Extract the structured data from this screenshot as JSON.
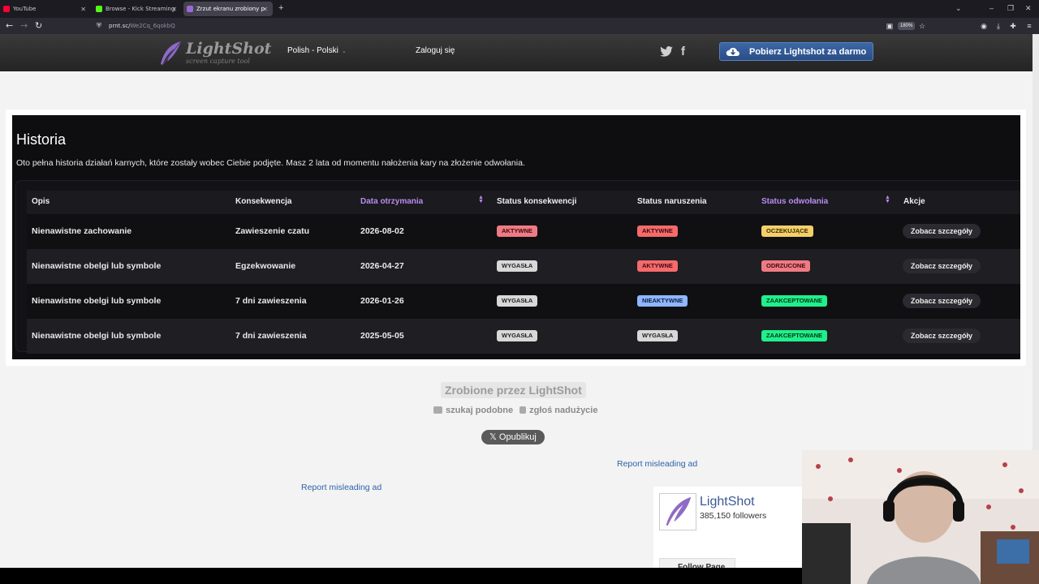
{
  "browser": {
    "tabs": [
      {
        "title": "YouTube",
        "color": "#ff0033"
      },
      {
        "title": "Browse - Kick Streaming",
        "color": "#53fc18"
      },
      {
        "title": "Zrzut ekranu zrobiony przez Li...",
        "color": "#9b6ad1"
      }
    ],
    "url": "prnt.sc/",
    "url_path": "We2Cq_6qokbQ",
    "zoom": "180%"
  },
  "header": {
    "logo_text": "LightShot",
    "logo_sub": "screen capture tool",
    "language": "Polish - Polski",
    "login": "Zaloguj się",
    "download_button": "Pobierz Lightshot za darmo"
  },
  "screenshot": {
    "title": "Historia",
    "description": "Oto pełna historia działań karnych, które zostały wobec Ciebie podjęte. Masz 2 lata od momentu nałożenia kary na złożenie odwołania.",
    "columns": [
      "Opis",
      "Konsekwencja",
      "Data otrzymania",
      "Status konsekwencji",
      "Status naruszenia",
      "Status odwołania",
      "Akcje"
    ],
    "rows": [
      {
        "opis": "Nienawistne zachowanie",
        "konsekwencja": "Zawieszenie czatu",
        "data": "2026-08-02",
        "status_konsekwencji": "AKTYWNE",
        "status_naruszenia": "AKTYWNE",
        "status_odwolania": "OCZEKUJĄCE",
        "akcja": "Zobacz szczegóły"
      },
      {
        "opis": "Nienawistne obelgi lub symbole",
        "konsekwencja": "Egzekwowanie",
        "data": "2026-04-27",
        "status_konsekwencji": "WYGASŁA",
        "status_naruszenia": "AKTYWNE",
        "status_odwolania": "ODRZUCONE",
        "akcja": "Zobacz szczegóły"
      },
      {
        "opis": "Nienawistne obelgi lub symbole",
        "konsekwencja": "7 dni zawieszenia",
        "data": "2026-01-26",
        "status_konsekwencji": "WYGASŁA",
        "status_naruszenia": "NIEAKTYWNE",
        "status_odwolania": "ZAAKCEPTOWANE",
        "akcja": "Zobacz szczegóły"
      },
      {
        "opis": "Nienawistne obelgi lub symbole",
        "konsekwencja": "7 dni zawieszenia",
        "data": "2025-05-05",
        "status_konsekwencji": "WYGASŁA",
        "status_naruszenia": "WYGASŁA",
        "status_odwolania": "ZAAKCEPTOWANE",
        "akcja": "Zobacz szczegóły"
      }
    ]
  },
  "footer": {
    "made_by": "Zrobione przez LightShot",
    "search_similar": "szukaj podobne",
    "report_abuse": "zgłoś nadużycie",
    "share_x": "Opublikuj",
    "report_ad": "Report misleading ad"
  },
  "facebook": {
    "page_name": "LightShot",
    "followers": "385,150 followers",
    "follow_button": "Follow Page"
  }
}
